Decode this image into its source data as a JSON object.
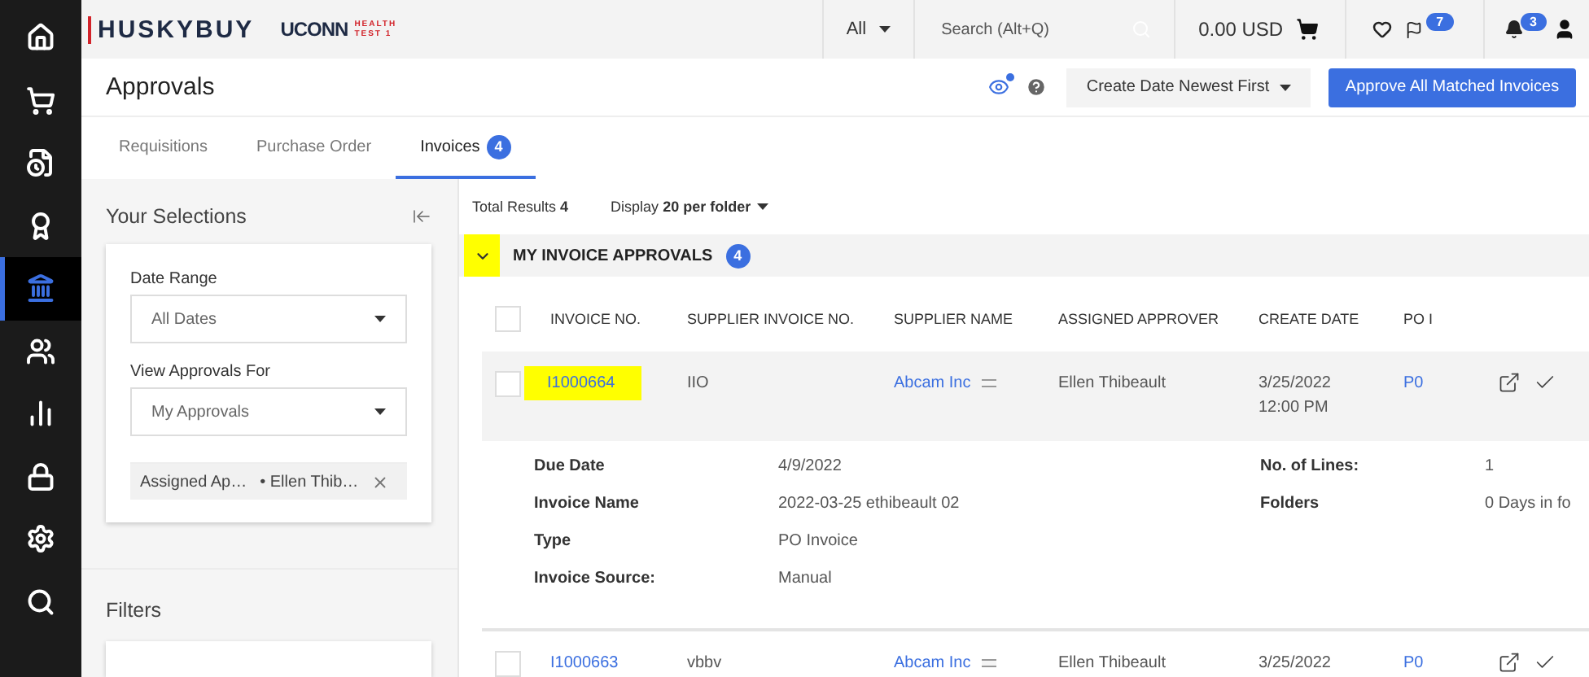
{
  "nav": [
    {
      "kind": "home",
      "selected": false
    },
    {
      "kind": "cart",
      "selected": false
    },
    {
      "kind": "document-clock",
      "selected": false
    },
    {
      "kind": "award",
      "selected": false
    },
    {
      "kind": "bank",
      "selected": true
    },
    {
      "kind": "users",
      "selected": false
    },
    {
      "kind": "chart",
      "selected": false
    },
    {
      "kind": "lock",
      "selected": false
    },
    {
      "kind": "gear",
      "selected": false
    },
    {
      "kind": "search",
      "selected": false
    }
  ],
  "header": {
    "brand": "HUSKYBUY",
    "org": "UCONN",
    "org_line1": "HEALTH",
    "org_line2": "TEST 1",
    "scope": "All",
    "search_placeholder": "Search (Alt+Q)",
    "cart_total": "0.00 USD",
    "flag_count": "7",
    "bell_count": "3"
  },
  "page": {
    "title": "Approvals",
    "sort": "Create Date Newest First",
    "primary_button": "Approve All Matched Invoices"
  },
  "tabs": [
    {
      "label": "Requisitions",
      "selected": false
    },
    {
      "label": "Purchase Order",
      "selected": false
    },
    {
      "label": "Invoices",
      "count": "4",
      "selected": true
    }
  ],
  "selections": {
    "title": "Your Selections",
    "fields": [
      {
        "label": "Date Range",
        "value": "All Dates"
      },
      {
        "label": "View Approvals For",
        "value": "My Approvals"
      }
    ],
    "chip": {
      "key": "Assigned Ap…",
      "value": "• Ellen Thib…"
    }
  },
  "filters": {
    "title": "Filters"
  },
  "results": {
    "total": "Total Results **4**",
    "display": "Display **20 per folder**"
  },
  "group": {
    "title": "MY INVOICE APPROVALS",
    "count": "4",
    "expanded": true,
    "highlighted": true
  },
  "select_all_checked": false,
  "columns": [
    "INVOICE NO.",
    "SUPPLIER INVOICE NO.",
    "SUPPLIER NAME",
    "ASSIGNED APPROVER",
    "CREATE DATE",
    "PO I"
  ],
  "rows": [
    {
      "checked": false,
      "invoice_no": "I1000664",
      "highlighted": true,
      "supplier_invoice_no": "IIO",
      "supplier_name": "Abcam Inc",
      "approver": "Ellen Thibeault",
      "create_date": "3/25/2022",
      "create_time": "12:00 PM",
      "po": "P0",
      "expanded": true,
      "details_left": [
        {
          "label": "Due Date",
          "value": "4/9/2022"
        },
        {
          "label": "Invoice Name",
          "value": "2022-03-25 ethibeault 02"
        },
        {
          "label": "Type",
          "value": "PO Invoice"
        },
        {
          "label": "Invoice Source:",
          "value": "Manual"
        }
      ],
      "details_right": [
        {
          "label": "No. of Lines:",
          "value": "1"
        },
        {
          "label": "Folders",
          "value": "0 Days in fo"
        }
      ]
    },
    {
      "checked": false,
      "invoice_no": "I1000663",
      "highlighted": false,
      "supplier_invoice_no": "vbbv",
      "supplier_name": "Abcam Inc",
      "approver": "Ellen Thibeault",
      "create_date": "3/25/2022",
      "po": "P0",
      "expanded": false
    }
  ]
}
